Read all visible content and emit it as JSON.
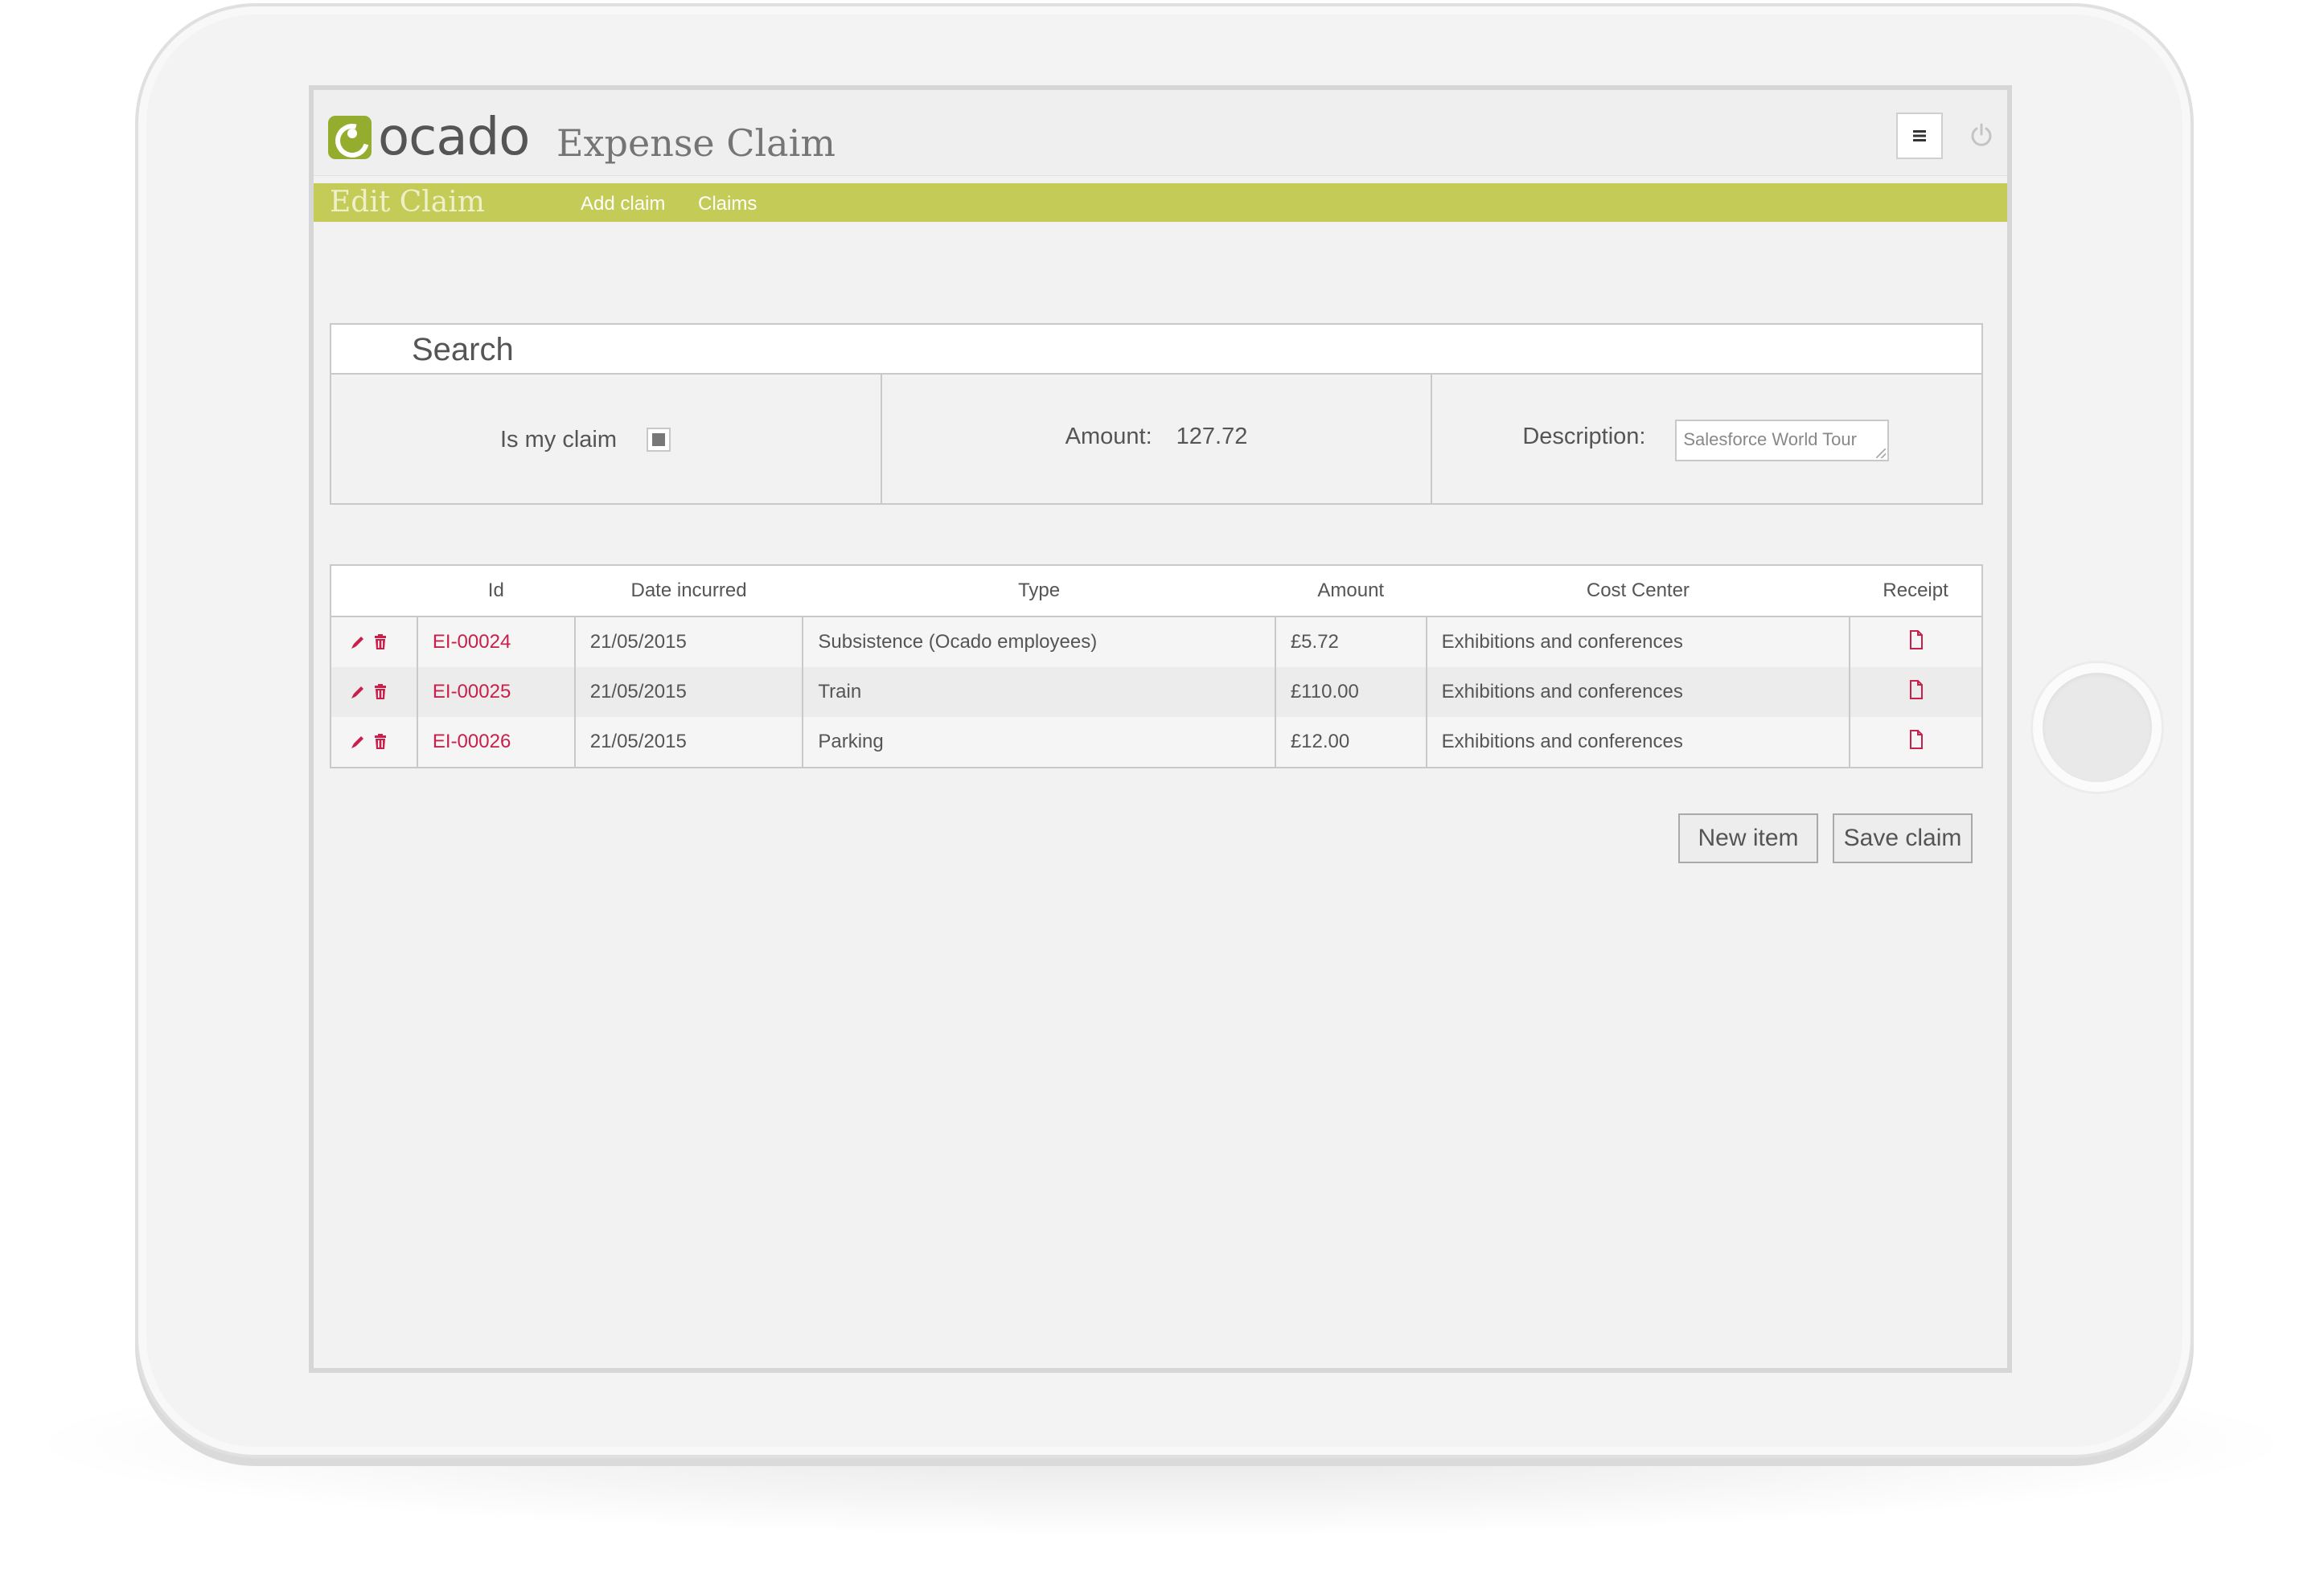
{
  "brand": {
    "logo_text": "ocado",
    "app_title": "Expense Claim",
    "accent_color": "#c4cb57",
    "logo_color": "#95ad2f",
    "link_color": "#c8204a"
  },
  "header": {
    "menu_icon": "hamburger-menu-icon",
    "power_icon": "power-icon"
  },
  "nav": {
    "title": "Edit Claim",
    "links": [
      "Add claim",
      "Claims"
    ]
  },
  "search": {
    "title": "Search",
    "is_my_claim_label": "Is my claim",
    "is_my_claim_checked": true,
    "amount_label": "Amount:",
    "amount_value": "127.72",
    "description_label": "Description:",
    "description_value": "Salesforce World Tour"
  },
  "table": {
    "columns": [
      "",
      "Id",
      "Date incurred",
      "Type",
      "Amount",
      "Cost Center",
      "Receipt"
    ],
    "rows": [
      {
        "id": "EI-00024",
        "date": "21/05/2015",
        "type": "Subsistence (Ocado employees)",
        "amount": "£5.72",
        "cost_center": "Exhibitions and conferences"
      },
      {
        "id": "EI-00025",
        "date": "21/05/2015",
        "type": "Train",
        "amount": "£110.00",
        "cost_center": "Exhibitions and conferences"
      },
      {
        "id": "EI-00026",
        "date": "21/05/2015",
        "type": "Parking",
        "amount": "£12.00",
        "cost_center": "Exhibitions and conferences"
      }
    ],
    "row_icons": [
      "edit-pencil-icon",
      "delete-trash-icon",
      "receipt-document-icon"
    ]
  },
  "buttons": {
    "new_item": "New item",
    "save_claim": "Save claim"
  }
}
